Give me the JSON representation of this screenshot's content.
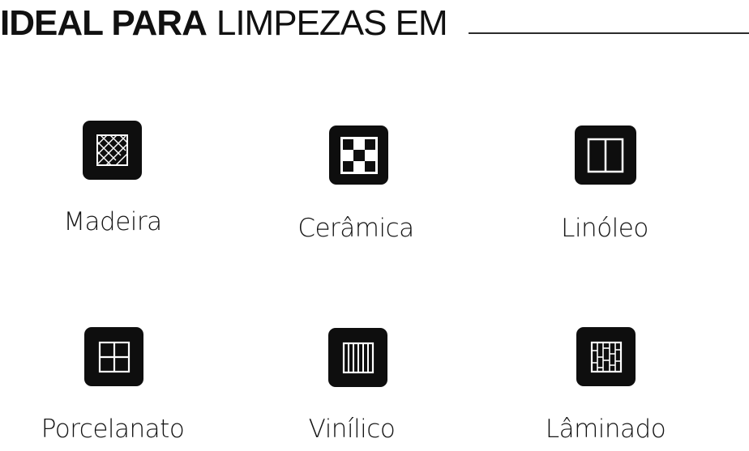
{
  "heading": {
    "bold": "IDEAL PARA",
    "light": "LIMPEZAS EM"
  },
  "colors": {
    "text": "#111111",
    "tile": "#0e0e0e",
    "icon": "#ffffff",
    "rule": "#2b2b2b"
  },
  "items": [
    {
      "label": "Madeira",
      "icon": "herringbone-floor-icon"
    },
    {
      "label": "Cerâmica",
      "icon": "checker-tile-icon"
    },
    {
      "label": "Linóleo",
      "icon": "two-panel-floor-icon"
    },
    {
      "label": "Porcelanato",
      "icon": "four-square-tile-icon"
    },
    {
      "label": "Vinílico",
      "icon": "vertical-plank-icon"
    },
    {
      "label": "Lâminado",
      "icon": "staggered-plank-icon"
    }
  ]
}
